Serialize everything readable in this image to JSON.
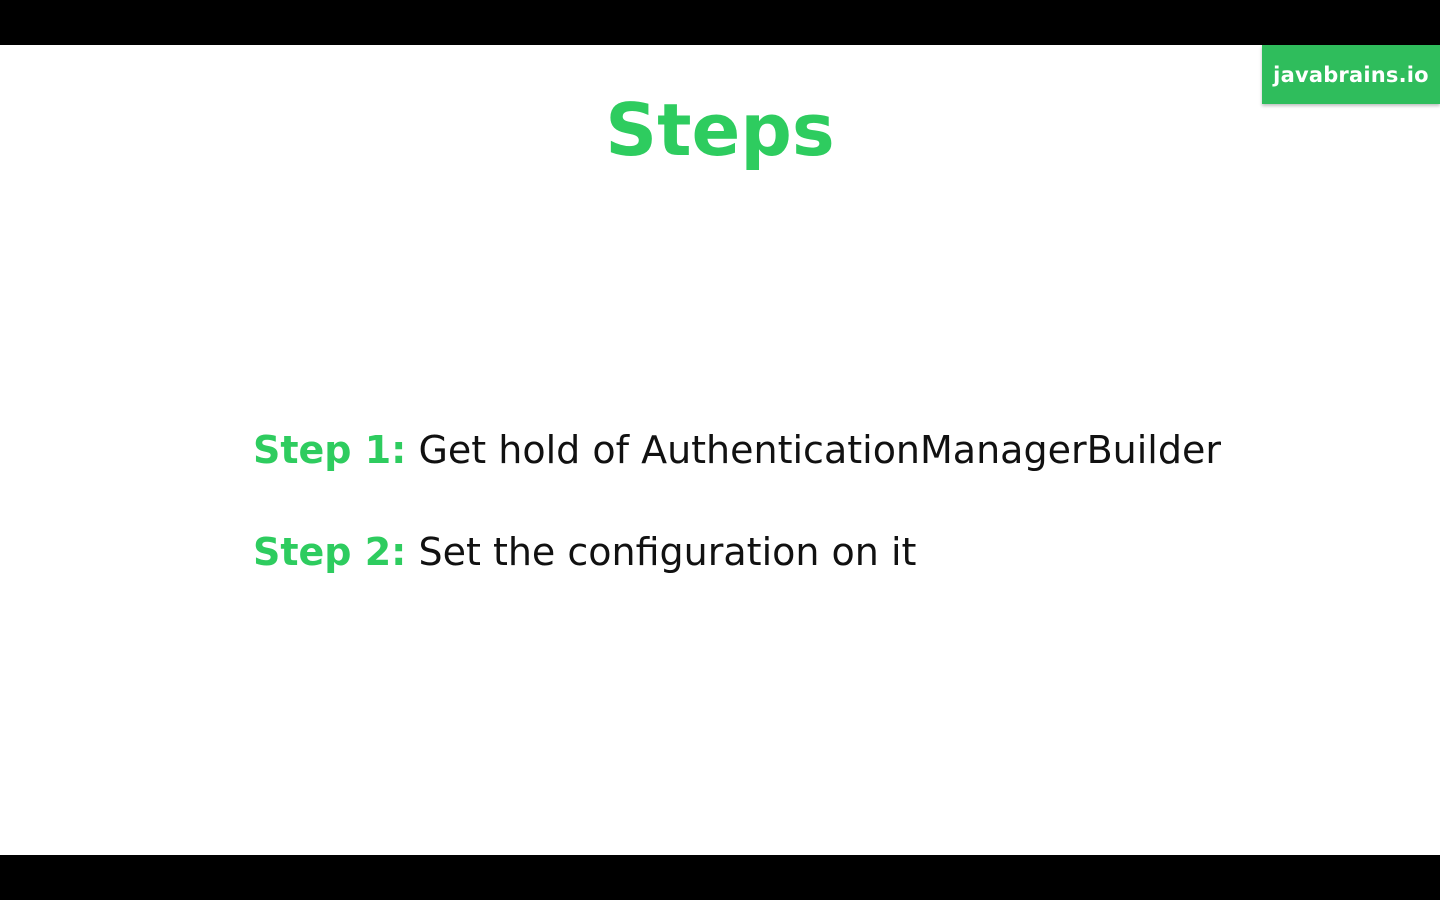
{
  "brand": {
    "label": "javabrains.io"
  },
  "slide": {
    "title": "Steps",
    "steps": [
      {
        "label": "Step 1:",
        "text": "Get hold of AuthenticationManagerBuilder"
      },
      {
        "label": "Step 2:",
        "text": "Set the configuration on it"
      }
    ]
  },
  "colors": {
    "accent": "#2ecc5f",
    "badge": "#2fbd5c",
    "text": "#111111",
    "background": "#ffffff",
    "letterbox": "#000000"
  }
}
